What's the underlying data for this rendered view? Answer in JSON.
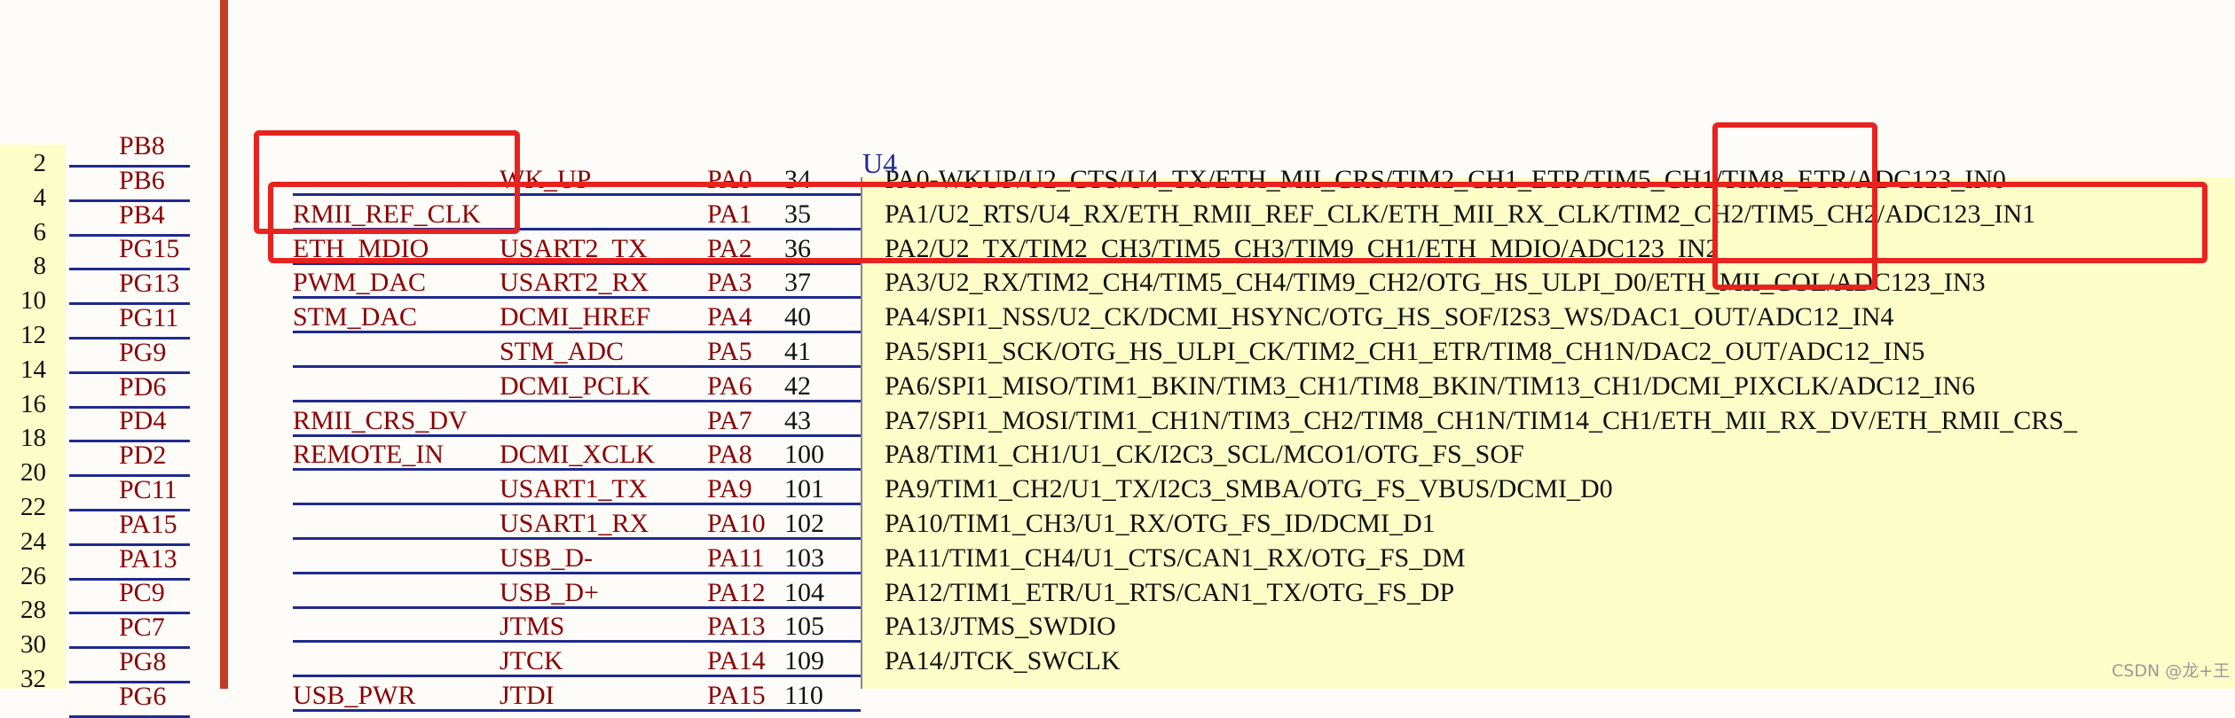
{
  "left_connector": {
    "pins": [
      {
        "num": "2",
        "port": "PB8"
      },
      {
        "num": "4",
        "port": "PB6"
      },
      {
        "num": "6",
        "port": "PB4"
      },
      {
        "num": "8",
        "port": "PG15"
      },
      {
        "num": "10",
        "port": "PG13"
      },
      {
        "num": "12",
        "port": "PG11"
      },
      {
        "num": "14",
        "port": "PG9"
      },
      {
        "num": "16",
        "port": "PD6"
      },
      {
        "num": "18",
        "port": "PD4"
      },
      {
        "num": "20",
        "port": "PD2"
      },
      {
        "num": "22",
        "port": "PC11"
      },
      {
        "num": "24",
        "port": "PA15"
      },
      {
        "num": "26",
        "port": "PA13"
      },
      {
        "num": "28",
        "port": "PC9"
      },
      {
        "num": "30",
        "port": "PC7"
      },
      {
        "num": "32",
        "port": "PG8"
      },
      {
        "num": "",
        "port": "PG6"
      }
    ]
  },
  "part_label": "U4",
  "nets": [
    {
      "net1": "",
      "net2": "WK_UP",
      "pin": "PA0",
      "num": "34",
      "desc": "PA0-WKUP/U2_CTS/U4_TX/ETH_MII_CRS/TIM2_CH1_ETR/TIM5_CH1/TIM8_ETR/ADC123_IN0"
    },
    {
      "net1": "RMII_REF_CLK",
      "net2": "",
      "pin": "PA1",
      "num": "35",
      "desc": "PA1/U2_RTS/U4_RX/ETH_RMII_REF_CLK/ETH_MII_RX_CLK/TIM2_CH2/TIM5_CH2/ADC123_IN1"
    },
    {
      "net1": "ETH_MDIO",
      "net2": "USART2_TX",
      "pin": "PA2",
      "num": "36",
      "desc": "PA2/U2_TX/TIM2_CH3/TIM5_CH3/TIM9_CH1/ETH_MDIO/ADC123_IN2"
    },
    {
      "net1": "PWM_DAC",
      "net2": "USART2_RX",
      "pin": "PA3",
      "num": "37",
      "desc": "PA3/U2_RX/TIM2_CH4/TIM5_CH4/TIM9_CH2/OTG_HS_ULPI_D0/ETH_MII_COL/ADC123_IN3"
    },
    {
      "net1": "STM_DAC",
      "net2": "DCMI_HREF",
      "pin": "PA4",
      "num": "40",
      "desc": "PA4/SPI1_NSS/U2_CK/DCMI_HSYNC/OTG_HS_SOF/I2S3_WS/DAC1_OUT/ADC12_IN4"
    },
    {
      "net1": "",
      "net2": "STM_ADC",
      "pin": "PA5",
      "num": "41",
      "desc": "PA5/SPI1_SCK/OTG_HS_ULPI_CK/TIM2_CH1_ETR/TIM8_CH1N/DAC2_OUT/ADC12_IN5"
    },
    {
      "net1": "",
      "net2": "DCMI_PCLK",
      "pin": "PA6",
      "num": "42",
      "desc": "PA6/SPI1_MISO/TIM1_BKIN/TIM3_CH1/TIM8_BKIN/TIM13_CH1/DCMI_PIXCLK/ADC12_IN6"
    },
    {
      "net1": "RMII_CRS_DV",
      "net2": "",
      "pin": "PA7",
      "num": "43",
      "desc": "PA7/SPI1_MOSI/TIM1_CH1N/TIM3_CH2/TIM8_CH1N/TIM14_CH1/ETH_MII_RX_DV/ETH_RMII_CRS_"
    },
    {
      "net1": "REMOTE_IN",
      "net2": "DCMI_XCLK",
      "pin": "PA8",
      "num": "100",
      "desc": "PA8/TIM1_CH1/U1_CK/I2C3_SCL/MCO1/OTG_FS_SOF"
    },
    {
      "net1": "",
      "net2": "USART1_TX",
      "pin": "PA9",
      "num": "101",
      "desc": "PA9/TIM1_CH2/U1_TX/I2C3_SMBA/OTG_FS_VBUS/DCMI_D0"
    },
    {
      "net1": "",
      "net2": "USART1_RX",
      "pin": "PA10",
      "num": "102",
      "desc": "PA10/TIM1_CH3/U1_RX/OTG_FS_ID/DCMI_D1"
    },
    {
      "net1": "",
      "net2": "USB_D-",
      "pin": "PA11",
      "num": "103",
      "desc": "PA11/TIM1_CH4/U1_CTS/CAN1_RX/OTG_FS_DM"
    },
    {
      "net1": "",
      "net2": "USB_D+",
      "pin": "PA12",
      "num": "104",
      "desc": "PA12/TIM1_ETR/U1_RTS/CAN1_TX/OTG_FS_DP"
    },
    {
      "net1": "",
      "net2": "JTMS",
      "pin": "PA13",
      "num": "105",
      "desc": "PA13/JTMS_SWDIO"
    },
    {
      "net1": "",
      "net2": "JTCK",
      "pin": "PA14",
      "num": "109",
      "desc": "PA14/JTCK_SWCLK"
    },
    {
      "net1": "USB_PWR",
      "net2": "JTDI",
      "pin": "PA15",
      "num": "110",
      "desc": ""
    }
  ],
  "watermark": "CSDN @龙+王",
  "colors": {
    "highlight": "#e8231f",
    "net": "#1f2a8f",
    "label": "#8b0000",
    "body": "#fdfdc8"
  }
}
